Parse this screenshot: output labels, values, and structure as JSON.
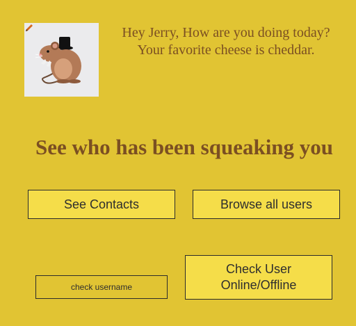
{
  "greeting": {
    "line1": "Hey Jerry, How are you doing today?",
    "line2": "Your favorite cheese is cheddar."
  },
  "avatar": {
    "icon": "mouse-with-top-hat",
    "edit_icon": "pencil-icon"
  },
  "headline": "See who has been squeaking you",
  "buttons": {
    "see_contacts": "See Contacts",
    "browse_users": "Browse all users",
    "check_status_line1": "Check User",
    "check_status_line2": "Online/Offline"
  },
  "username_input": {
    "placeholder": "check username",
    "value": ""
  },
  "colors": {
    "background": "#e1c433",
    "button": "#f5dd49",
    "text_brown": "#7b4f22"
  }
}
